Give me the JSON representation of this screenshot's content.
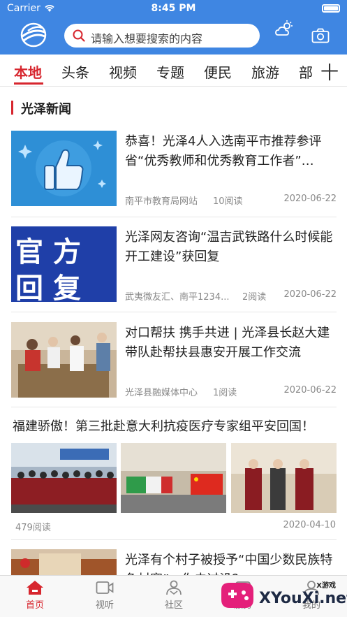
{
  "status_bar": {
    "carrier": "Carrier",
    "time": "8:45 PM"
  },
  "header": {
    "search_placeholder": "请输入想要搜索的内容",
    "icons": [
      "app-logo-icon",
      "search-icon",
      "weather-icon",
      "camera-icon"
    ]
  },
  "tabs": [
    "本地",
    "头条",
    "视频",
    "专题",
    "便民",
    "旅游",
    "部"
  ],
  "active_tab": "本地",
  "section_title": "光泽新闻",
  "news": [
    {
      "title": "恭喜！光泽4人入选南平市推荐参评省“优秀教师和优秀教育工作者”…",
      "source": "南平市教育局网站",
      "reads": "10阅读",
      "date": "2020-06-22"
    },
    {
      "title": "光泽网友咨询“温吉武铁路什么时候能开工建设”获回复",
      "source": "武夷微友汇、南平1234...",
      "reads": "2阅读",
      "date": "2020-06-22",
      "thumb_text": [
        "官方",
        "回复"
      ]
    },
    {
      "title": "对口帮扶 携手共进 | 光泽县长赵大建带队赴帮扶县惠安开展工作交流",
      "source": "光泽县融媒体中心",
      "reads": "1阅读",
      "date": "2020-06-22"
    }
  ],
  "feature": {
    "title": "福建骄傲！第三批赴意大利抗疫医疗专家组平安回国！",
    "reads": "479阅读",
    "date": "2020-04-10"
  },
  "last_news": {
    "title": "光泽有个村子被授予“中国少数民族特色村寨”，你去过没？"
  },
  "tabbar": [
    {
      "label": "首页",
      "icon": "home-icon"
    },
    {
      "label": "视听",
      "icon": "video-icon"
    },
    {
      "label": "社区",
      "icon": "community-icon"
    },
    {
      "label": "服务",
      "icon": "service-icon"
    },
    {
      "label": "我的",
      "icon": "profile-icon"
    }
  ],
  "watermark": {
    "top": "X游戏",
    "text": "XYouXi.net"
  },
  "colors": {
    "brand_blue": "#3f86e2",
    "accent_red": "#d7262e"
  }
}
